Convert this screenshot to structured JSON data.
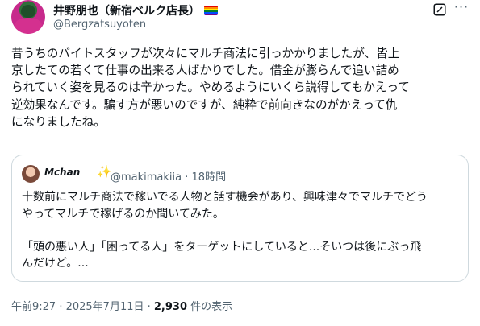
{
  "author": {
    "display_name": "井野朋也（新宿ベルク店長）",
    "handle": "@Bergzatsuyoten"
  },
  "icons": {
    "avatar": "profile-photo",
    "pride": "rainbow-flag-icon",
    "grok": "grok-icon",
    "more": "more-options-icon",
    "sparkle": "sparkles-emoji"
  },
  "tweet": {
    "lines": [
      "昔うちのバイトスタッフが次々にマルチ商法に引っかかりましたが、皆上",
      "京したての若くて仕事の出来る人ばかりでした。借金が膨らんで追い詰め",
      "られていく姿を見るのは辛かった。やめるようにいくら説得してもかえって",
      "逆効果なんです。騙す方が悪いのですが、純粋で前向きなのがかえって仇",
      "になりましたね。"
    ]
  },
  "quote": {
    "name": "Mchan",
    "handle": "@makimakiia",
    "time": "18時間",
    "lines": [
      "十数前にマルチ商法で稼いでる人物と話す機会があり、興味津々でマルチでどう",
      "やってマルチで稼げるのか聞いてみた。",
      "",
      "「頭の悪い人」「困ってる人」をターゲットにしていると...そいつは後にぶっ飛",
      "んだけど。..."
    ]
  },
  "footer": {
    "timestamp": "午前9:27 · 2025年7月11日 · ",
    "views_count": "2,930",
    "views_label": " 件の表示"
  },
  "colors": {
    "text": "#0f1419",
    "secondary": "#536471",
    "border": "#cfd9de"
  }
}
